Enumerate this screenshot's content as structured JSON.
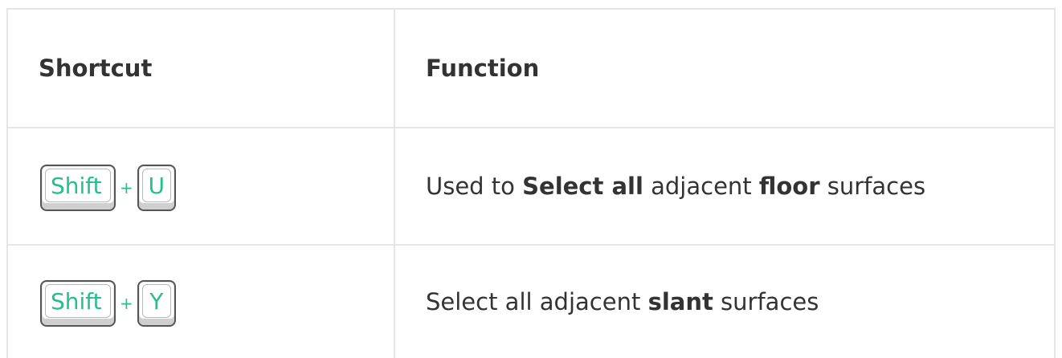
{
  "table": {
    "headers": [
      "Shortcut",
      "Function"
    ],
    "rows": [
      {
        "keys": [
          "Shift",
          "U"
        ],
        "plus": "+",
        "description": [
          {
            "text": "Used to ",
            "bold": false
          },
          {
            "text": "Select all",
            "bold": true
          },
          {
            "text": " adjacent ",
            "bold": false
          },
          {
            "text": "floor",
            "bold": true
          },
          {
            "text": " surfaces",
            "bold": false
          }
        ]
      },
      {
        "keys": [
          "Shift",
          "Y"
        ],
        "plus": "+",
        "description": [
          {
            "text": "Select all adjacent ",
            "bold": false
          },
          {
            "text": "slant",
            "bold": true
          },
          {
            "text": " surfaces",
            "bold": false
          }
        ]
      }
    ]
  },
  "colors": {
    "key_text": "#22c08e",
    "body_text": "#333333",
    "border": "#e6e6e6"
  }
}
